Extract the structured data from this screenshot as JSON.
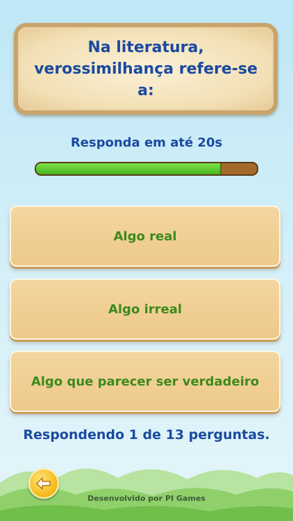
{
  "question": {
    "line1": "Na literatura,",
    "line2": "verossimilhança refere-se a:"
  },
  "timer": {
    "label": "Responda em até 20s",
    "remaining_fraction": 0.84,
    "fill_color": "#56c425",
    "track_color": "#a36a2a"
  },
  "answers": [
    {
      "label": "Algo real"
    },
    {
      "label": "Algo irreal"
    },
    {
      "label": "Algo que parecer ser verdadeiro"
    }
  ],
  "progress": {
    "text": "Respondendo 1 de 13 perguntas."
  },
  "footer": {
    "back_icon": "arrow-left-icon",
    "credits": "Desenvolvido por PI Games"
  },
  "colors": {
    "question_text": "#1a4aa0",
    "answer_text": "#3c8a1c",
    "board": "#f2dfb4"
  }
}
